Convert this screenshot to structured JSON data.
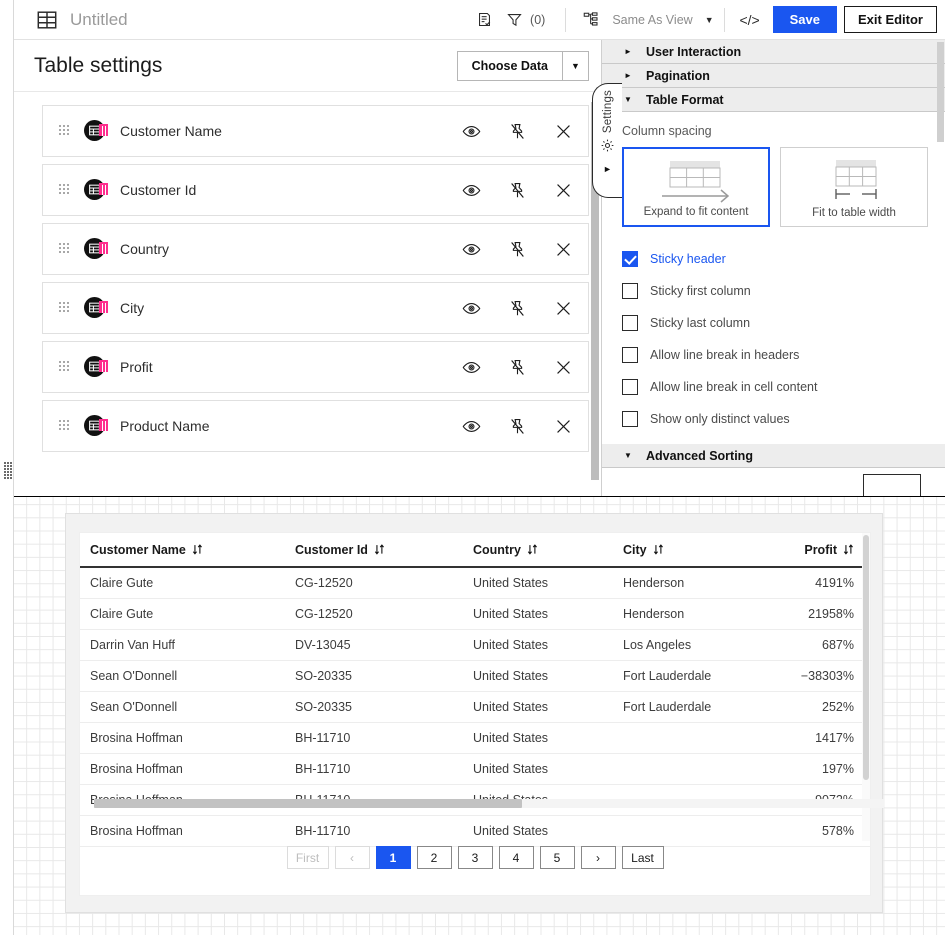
{
  "header": {
    "title": "Untitled",
    "notes_icon": "note-check-icon",
    "filter_icon": "filter-icon",
    "filter_count": "(0)",
    "hierarchy_icon": "hierarchy-icon",
    "view_label": "Same As View",
    "view_caret": "▼",
    "code_label": "</>",
    "save_label": "Save",
    "exit_label": "Exit Editor"
  },
  "left_pane": {
    "title": "Table settings",
    "choose_data_label": "Choose Data",
    "choose_data_caret": "▼",
    "fields": [
      {
        "label": "Customer Name"
      },
      {
        "label": "Customer Id"
      },
      {
        "label": "Country"
      },
      {
        "label": "City"
      },
      {
        "label": "Profit"
      },
      {
        "label": "Product Name"
      }
    ],
    "row_actions": {
      "visibility": "eye-icon",
      "pin": "pin-off-icon",
      "remove": "close-icon"
    }
  },
  "settings_tab": {
    "label": "Settings",
    "gear_icon": "gear-icon",
    "collapse_caret": "►"
  },
  "right_pane": {
    "sections": [
      {
        "label": "User Interaction",
        "expanded": false,
        "caret": "►"
      },
      {
        "label": "Pagination",
        "expanded": false,
        "caret": "►"
      },
      {
        "label": "Table Format",
        "expanded": true,
        "caret": "▼"
      }
    ],
    "column_spacing": {
      "label": "Column spacing",
      "options": [
        {
          "label": "Expand to fit content",
          "selected": true
        },
        {
          "label": "Fit to table width",
          "selected": false
        }
      ]
    },
    "checkboxes": [
      {
        "label": "Sticky header",
        "checked": true
      },
      {
        "label": "Sticky first column",
        "checked": false
      },
      {
        "label": "Sticky last column",
        "checked": false
      },
      {
        "label": "Allow line break in headers",
        "checked": false
      },
      {
        "label": "Allow line break in cell content",
        "checked": false
      },
      {
        "label": "Show only distinct values",
        "checked": false
      }
    ],
    "advanced_sorting": {
      "label": "Advanced Sorting",
      "caret": "▼"
    }
  },
  "preview": {
    "columns": [
      {
        "label": "Customer Name",
        "align": "left"
      },
      {
        "label": "Customer Id",
        "align": "left"
      },
      {
        "label": "Country",
        "align": "left"
      },
      {
        "label": "City",
        "align": "left"
      },
      {
        "label": "Profit",
        "align": "right"
      }
    ],
    "sort_icon": "sort-updown-icon",
    "rows": [
      [
        "Claire Gute",
        "CG-12520",
        "United States",
        "Henderson",
        "4191%"
      ],
      [
        "Claire Gute",
        "CG-12520",
        "United States",
        "Henderson",
        "21958%"
      ],
      [
        "Darrin Van Huff",
        "DV-13045",
        "United States",
        "Los Angeles",
        "687%"
      ],
      [
        "Sean O'Donnell",
        "SO-20335",
        "United States",
        "Fort Lauderdale",
        "−38303%"
      ],
      [
        "Sean O'Donnell",
        "SO-20335",
        "United States",
        "Fort Lauderdale",
        "252%"
      ],
      [
        "Brosina Hoffman",
        "BH-11710",
        "United States",
        "",
        "1417%"
      ],
      [
        "Brosina Hoffman",
        "BH-11710",
        "United States",
        "",
        "197%"
      ],
      [
        "Brosina Hoffman",
        "BH-11710",
        "United States",
        "",
        "9072%"
      ],
      [
        "Brosina Hoffman",
        "BH-11710",
        "United States",
        "",
        "578%"
      ]
    ],
    "pagination": [
      {
        "label": "First",
        "state": "disabled"
      },
      {
        "label": "‹",
        "state": "disabled"
      },
      {
        "label": "1",
        "state": "active"
      },
      {
        "label": "2",
        "state": "normal"
      },
      {
        "label": "3",
        "state": "normal"
      },
      {
        "label": "4",
        "state": "normal"
      },
      {
        "label": "5",
        "state": "normal"
      },
      {
        "label": "›",
        "state": "normal"
      },
      {
        "label": "Last",
        "state": "normal"
      }
    ]
  },
  "colors": {
    "accent": "#1a56f0",
    "badge_pink": "#ff2d8e",
    "panel_header": "#ededed",
    "muted_text": "#9a9a9a"
  }
}
